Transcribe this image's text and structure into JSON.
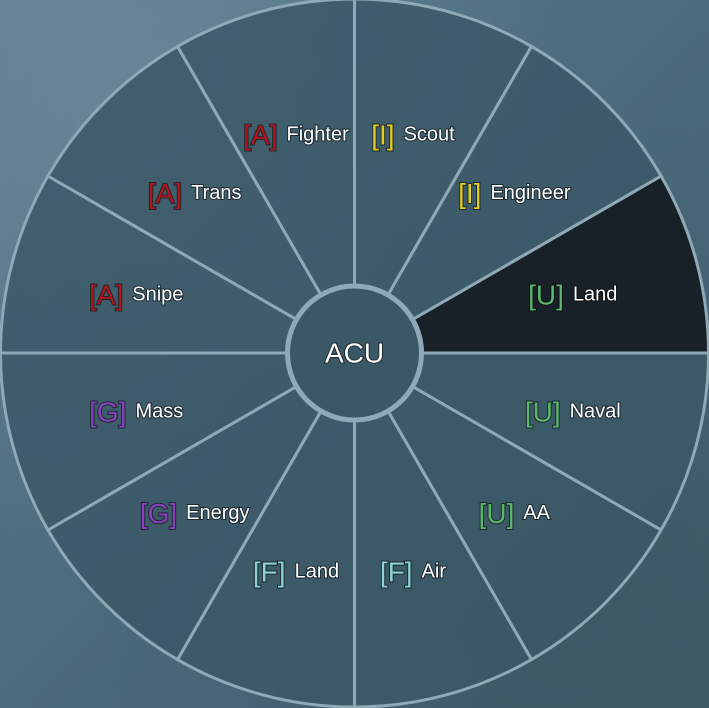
{
  "wheel": {
    "center_label": "ACU",
    "selected_index": 0,
    "colors": {
      "segment_fill": "#3b5866",
      "segment_selected_fill": "#172127",
      "segment_stroke": "#8fa9b6",
      "center_fill": "#3b5866",
      "A": "#b3131c",
      "I": "#e3cd1f",
      "U": "#59b86a",
      "G": "#8b3fbf",
      "F": "#8ed3d4"
    },
    "segments": [
      {
        "tag": "[U]",
        "group": "U",
        "label": "Land",
        "icon": "unit-land"
      },
      {
        "tag": "[U]",
        "group": "U",
        "label": "Naval",
        "icon": "unit-naval"
      },
      {
        "tag": "[U]",
        "group": "U",
        "label": "AA",
        "icon": "unit-aa"
      },
      {
        "tag": "[F]",
        "group": "F",
        "label": "Air",
        "icon": "factory-air"
      },
      {
        "tag": "[F]",
        "group": "F",
        "label": "Land",
        "icon": "factory-land"
      },
      {
        "tag": "[G]",
        "group": "G",
        "label": "Energy",
        "icon": "generator-energy"
      },
      {
        "tag": "[G]",
        "group": "G",
        "label": "Mass",
        "icon": "generator-mass"
      },
      {
        "tag": "[A]",
        "group": "A",
        "label": "Snipe",
        "icon": "attack-snipe"
      },
      {
        "tag": "[A]",
        "group": "A",
        "label": "Trans",
        "icon": "attack-trans"
      },
      {
        "tag": "[A]",
        "group": "A",
        "label": "Fighter",
        "icon": "attack-fighter"
      },
      {
        "tag": "[I]",
        "group": "I",
        "label": "Scout",
        "icon": "intel-scout"
      },
      {
        "tag": "[I]",
        "group": "I",
        "label": "Engineer",
        "icon": "intel-engineer"
      }
    ]
  }
}
